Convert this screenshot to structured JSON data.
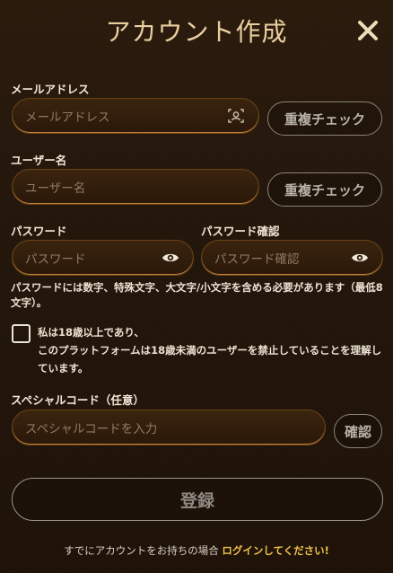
{
  "header": {
    "title": "アカウント作成"
  },
  "email": {
    "label": "メールアドレス",
    "placeholder": "メールアドレス",
    "check_button": "重複チェック"
  },
  "username": {
    "label": "ユーザー名",
    "placeholder": "ユーザー名",
    "check_button": "重複チェック"
  },
  "password": {
    "label": "パスワード",
    "placeholder": "パスワード"
  },
  "password_confirm": {
    "label": "パスワード確認",
    "placeholder": "パスワード確認"
  },
  "password_note": "パスワードには数字、特殊文字、大文字/小文字を含める必要があります（最低8文字）。",
  "agreement": {
    "line1": "私は18歳以上であり、",
    "line2": "このプラットフォームは18歳未満のユーザーを禁止していることを理解しています。",
    "checked": false
  },
  "special_code": {
    "label": "スペシャルコード（任意）",
    "placeholder": "スペシャルコードを入力",
    "confirm_button": "確認"
  },
  "register_button": "登録",
  "footer": {
    "prompt": "すでにアカウントをお持ちの場合 ",
    "login_link": "ログインしてください!"
  },
  "colors": {
    "accent_gold": "#e9cfa0",
    "link": "#f0c24a",
    "input_border": "#c4823b"
  }
}
